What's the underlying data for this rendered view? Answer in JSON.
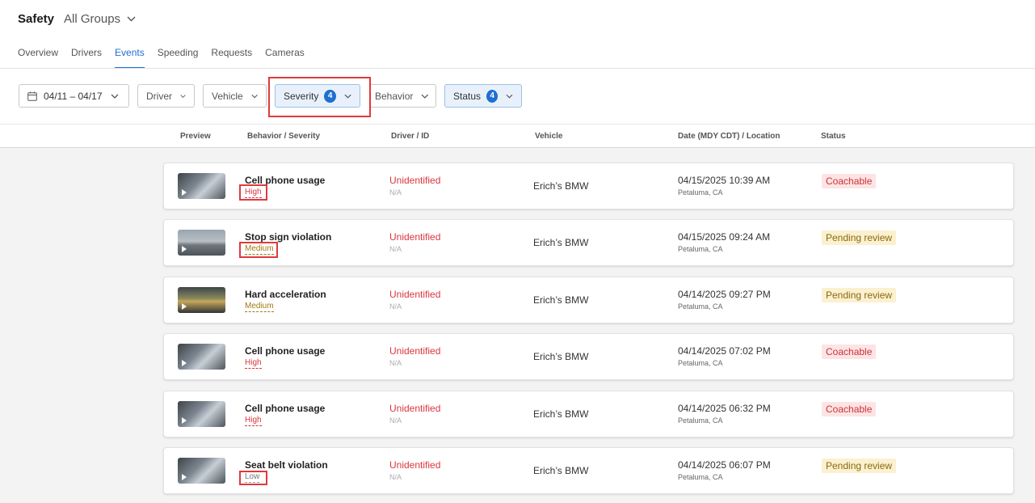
{
  "header": {
    "title": "Safety",
    "group": "All Groups"
  },
  "tabs": [
    {
      "label": "Overview"
    },
    {
      "label": "Drivers"
    },
    {
      "label": "Events",
      "active": true
    },
    {
      "label": "Speeding"
    },
    {
      "label": "Requests"
    },
    {
      "label": "Cameras"
    }
  ],
  "filters": {
    "date": "04/11 – 04/17",
    "driver": "Driver",
    "vehicle": "Vehicle",
    "severity": "Severity",
    "severity_count": "4",
    "behavior": "Behavior",
    "status": "Status",
    "status_count": "4"
  },
  "table": {
    "headers": {
      "preview": "Preview",
      "behavior": "Behavior / Severity",
      "driver": "Driver / ID",
      "vehicle": "Vehicle",
      "date": "Date (MDY CDT) / Location",
      "status": "Status"
    },
    "rows": [
      {
        "behavior": "Cell phone usage",
        "severity": "High",
        "driver": "Unidentified",
        "driver_id": "N/A",
        "vehicle": "Erich’s BMW",
        "datetime": "04/15/2025 10:39 AM",
        "location": "Petaluma, CA",
        "status": "Coachable"
      },
      {
        "behavior": "Stop sign violation",
        "severity": "Medium",
        "driver": "Unidentified",
        "driver_id": "N/A",
        "vehicle": "Erich’s BMW",
        "datetime": "04/15/2025 09:24 AM",
        "location": "Petaluma, CA",
        "status": "Pending review"
      },
      {
        "behavior": "Hard acceleration",
        "severity": "Medium",
        "driver": "Unidentified",
        "driver_id": "N/A",
        "vehicle": "Erich’s BMW",
        "datetime": "04/14/2025 09:27 PM",
        "location": "Petaluma, CA",
        "status": "Pending review"
      },
      {
        "behavior": "Cell phone usage",
        "severity": "High",
        "driver": "Unidentified",
        "driver_id": "N/A",
        "vehicle": "Erich’s BMW",
        "datetime": "04/14/2025 07:02 PM",
        "location": "Petaluma, CA",
        "status": "Coachable"
      },
      {
        "behavior": "Cell phone usage",
        "severity": "High",
        "driver": "Unidentified",
        "driver_id": "N/A",
        "vehicle": "Erich’s BMW",
        "datetime": "04/14/2025 06:32 PM",
        "location": "Petaluma, CA",
        "status": "Coachable"
      },
      {
        "behavior": "Seat belt violation",
        "severity": "Low",
        "driver": "Unidentified",
        "driver_id": "N/A",
        "vehicle": "Erich’s BMW",
        "datetime": "04/14/2025 06:07 PM",
        "location": "Petaluma, CA",
        "status": "Pending review"
      }
    ]
  },
  "colors": {
    "accent": "#1f6fd1",
    "callout": "#e0393e",
    "severity_high": "#d9363e",
    "severity_medium": "#a07a10",
    "coachable_bg": "#fde4e4",
    "pending_bg": "#fbf0cf"
  }
}
